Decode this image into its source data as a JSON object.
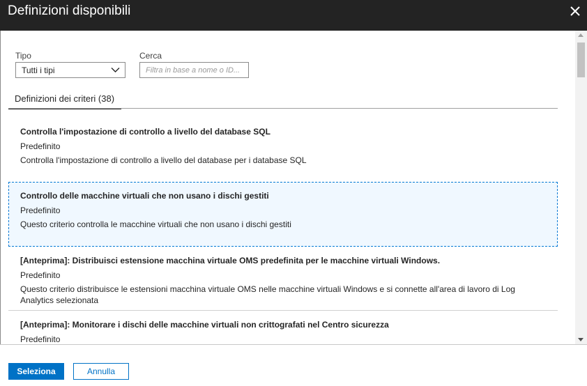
{
  "dialog": {
    "title": "Definizioni disponibili",
    "close_icon": "close-icon"
  },
  "filters": {
    "type_label": "Tipo",
    "type_value": "Tutti i tipi",
    "search_label": "Cerca",
    "search_placeholder": "Filtra in base a nome o ID..."
  },
  "tabs": [
    {
      "label": "Definizioni dei criteri (38)",
      "active": true
    }
  ],
  "definitions": [
    {
      "title": "Controlla l'impostazione di controllo a livello del database SQL",
      "type": "Predefinito",
      "description": "Controlla l'impostazione di controllo a livello del database per i database SQL",
      "selected": false
    },
    {
      "title": "Controllo delle macchine virtuali che non usano i dischi gestiti",
      "type": "Predefinito",
      "description": "Questo criterio controlla le macchine virtuali che non usano i dischi gestiti",
      "selected": true
    },
    {
      "title": "[Anteprima]: Distribuisci estensione macchina virtuale OMS predefinita per le macchine virtuali Windows.",
      "type": "Predefinito",
      "description": "Questo criterio distribuisce le estensioni macchina virtuale OMS nelle macchine virtuali Windows e si connette all'area di lavoro di Log Analytics selezionata",
      "selected": false
    },
    {
      "title": "[Anteprima]: Monitorare i dischi delle macchine virtuali non crittografati nel Centro sicurezza",
      "type": "Predefinito",
      "description": "",
      "selected": false
    }
  ],
  "footer": {
    "select_label": "Seleziona",
    "cancel_label": "Annulla"
  },
  "colors": {
    "header_bg": "#232323",
    "accent": "#0072c6",
    "selection_border": "#0078d4"
  }
}
